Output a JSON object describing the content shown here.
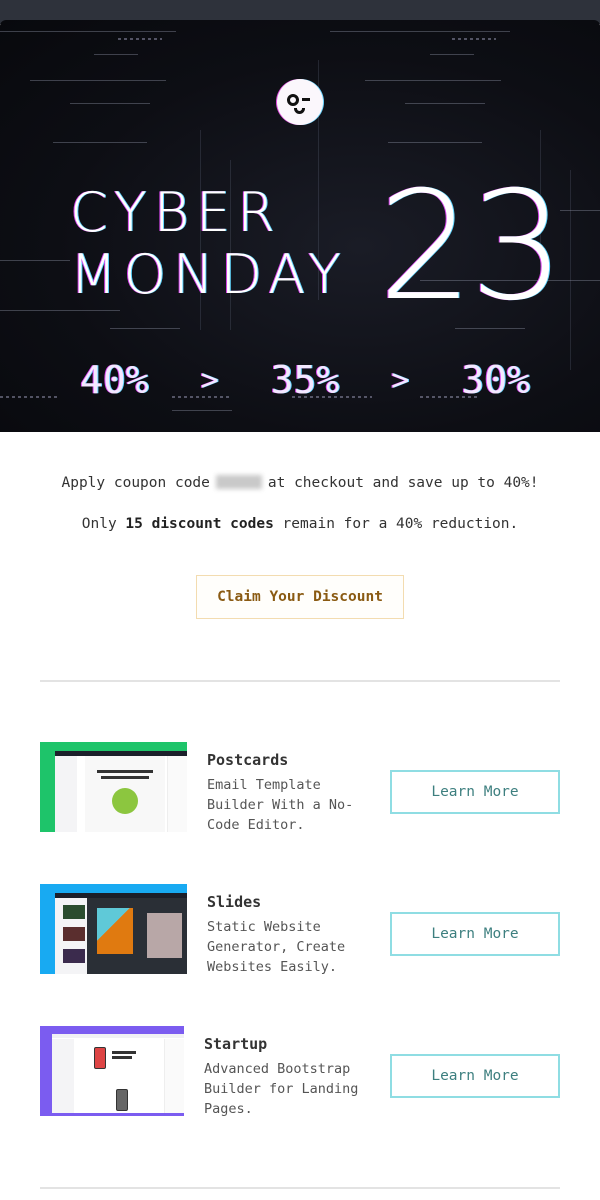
{
  "hero": {
    "logo": "winking-face-logo",
    "title_line1": "CYBER",
    "title_line2": "MONDAY",
    "title_number": "23",
    "discount_tiers": [
      "40%",
      "35%",
      "30%"
    ],
    "tier_separator": ">",
    "accent_colors": {
      "magenta": "#d946ef",
      "cyan": "#60d7ff"
    }
  },
  "promo": {
    "line1_before": "Apply coupon code",
    "coupon_code_hidden": true,
    "line1_after": "at checkout and save up to 40%!",
    "line2_before": "Only",
    "line2_bold": "15 discount codes",
    "line2_after": "remain for a 40% reduction."
  },
  "cta": {
    "label": "Claim Your Discount",
    "color": "#8a5a12",
    "border": "#f3dcb0"
  },
  "products": [
    {
      "name": "Postcards",
      "description": "Email Template Builder With a No-Code Editor.",
      "button": "Learn More",
      "thumb_color": "#1ec46a"
    },
    {
      "name": "Slides",
      "description": "Static Website Generator, Create Websites Easily.",
      "button": "Learn More",
      "thumb_color": "#18aaf2"
    },
    {
      "name": "Startup",
      "description": "Advanced Bootstrap Builder for Landing Pages.",
      "button": "Learn More",
      "thumb_color": "#7b5cf0"
    }
  ],
  "learn_button_border": "#8fdde3"
}
